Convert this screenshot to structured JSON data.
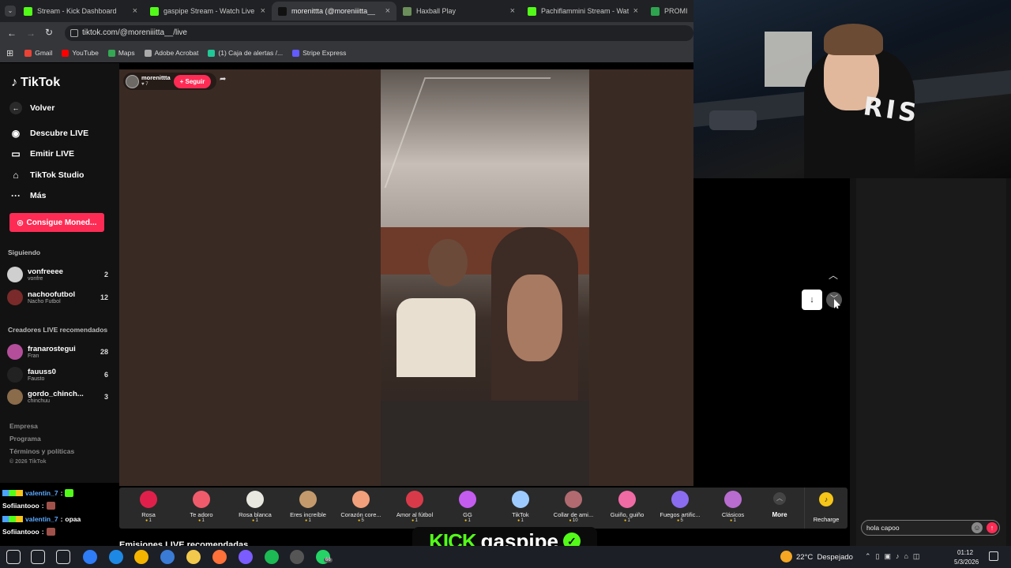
{
  "browser": {
    "tabs": [
      {
        "title": "Stream - Kick Dashboard",
        "fav_color": "#53fc18",
        "active": false
      },
      {
        "title": "gaspipe Stream - Watch Live on",
        "fav_color": "#53fc18",
        "active": false
      },
      {
        "title": "morenittta (@moreniiitta__",
        "fav_color": "#111111",
        "active": true
      },
      {
        "title": "Haxball Play",
        "fav_color": "#6b8e5a",
        "active": false
      },
      {
        "title": "Pachiflammini Stream - Watch L",
        "fav_color": "#53fc18",
        "active": false
      },
      {
        "title": "PROMIEDO",
        "fav_color": "#2ea44f",
        "active": false
      }
    ],
    "url": "tiktok.com/@moreniiitta__/live",
    "bookmarks": [
      "Gmail",
      "YouTube",
      "Maps",
      "Adobe Acrobat",
      "(1) Caja de alertas /...",
      "Stripe Express"
    ]
  },
  "sidebar": {
    "logo": "TikTok",
    "back": "Volver",
    "nav": [
      {
        "label": "Descubre LIVE",
        "icon": "live-discover-icon"
      },
      {
        "label": "Emitir LIVE",
        "icon": "broadcast-icon"
      },
      {
        "label": "TikTok Studio",
        "icon": "home-studio-icon"
      },
      {
        "label": "Más",
        "icon": "more-dots-icon"
      }
    ],
    "coins_button": "Consigue Moned...",
    "following_title": "Siguiendo",
    "following": [
      {
        "name": "vonfreeee",
        "sub": "vonfre",
        "count": "2"
      },
      {
        "name": "nachoofutbol",
        "sub": "Nacho Futbol",
        "count": "12"
      }
    ],
    "recommended_title": "Creadores LIVE recomendados",
    "recommended": [
      {
        "name": "franarostegui",
        "sub": "Fran",
        "count": "28"
      },
      {
        "name": "fauuss0",
        "sub": "Fausto",
        "count": "6"
      },
      {
        "name": "gordo_chinch...",
        "sub": "chinchuu",
        "count": "3"
      }
    ],
    "footer": [
      "Empresa",
      "Programa",
      "Términos y políticas",
      "© 2026 TikTok"
    ]
  },
  "stream": {
    "host": "morenittta",
    "viewers": "7",
    "follow_label": "+ Seguir",
    "bottom_heading": "Emisiones LIVE recomendadas",
    "gifts": [
      {
        "name": "Rosa",
        "cost": "1",
        "color": "#e0204a"
      },
      {
        "name": "Te adoro",
        "cost": "1",
        "color": "#f05b6b"
      },
      {
        "name": "Rosa blanca",
        "cost": "1",
        "color": "#e8e8e0"
      },
      {
        "name": "Eres increíble",
        "cost": "1",
        "color": "#c49a6c"
      },
      {
        "name": "Corazón core...",
        "cost": "5",
        "color": "#f2a07b"
      },
      {
        "name": "Amor al fútbol",
        "cost": "1",
        "color": "#d93a4a"
      },
      {
        "name": "GG",
        "cost": "1",
        "color": "#c45cf0"
      },
      {
        "name": "TikTok",
        "cost": "1",
        "color": "#9ecbff"
      },
      {
        "name": "Collar de ami...",
        "cost": "10",
        "color": "#b06a70"
      },
      {
        "name": "Guiño, guiño",
        "cost": "1",
        "color": "#f06aa4"
      },
      {
        "name": "Fuegos artific...",
        "cost": "5",
        "color": "#8a6cf0"
      },
      {
        "name": "Clásicos",
        "cost": "1",
        "color": "#b86ccf"
      }
    ],
    "more_label": "More",
    "recharge_label": "Recharge"
  },
  "overlay_chat": [
    {
      "user": "valentin_7",
      "msg": ""
    },
    {
      "user": "Sofiiantooo",
      "msg": ""
    },
    {
      "user": "valentin_7",
      "msg": "opaa"
    },
    {
      "user": "Sofiiantooo",
      "msg": ""
    }
  ],
  "kick_brand": {
    "logo": "KICK",
    "channel": "gaspipe"
  },
  "chat_input": {
    "value": "hola capoo"
  },
  "taskbar": {
    "weather": "22°C  Despejado",
    "time": "01:12",
    "date": "5/3/2026",
    "badge": "66"
  }
}
